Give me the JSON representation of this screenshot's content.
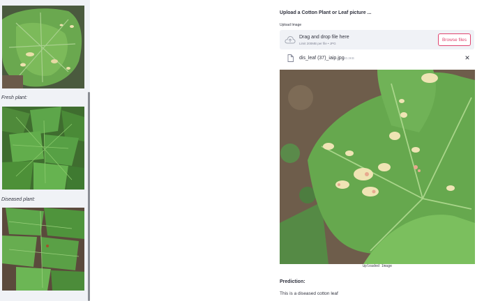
{
  "sidebar": {
    "captions": {
      "fresh": "Fresh plant:",
      "diseased": "Diseased plant:"
    }
  },
  "main": {
    "header": "Upload a Cotton Plant or Leaf picture ...",
    "uploader": {
      "label": "Upload Image",
      "drop_title": "Drag and drop file here",
      "limit_text": "Limit 200MB per file • JPG",
      "browse_label": "Browse files"
    },
    "file": {
      "name": "dis_leaf (37)_iaip.jpg",
      "size": "40.3KB",
      "remove_symbol": "✕"
    },
    "image_caption": "Uploaded Image",
    "prediction_label": "Prediction:",
    "prediction_text": "This is a diseased cotton leaf"
  },
  "colors": {
    "accent": "#e0436f",
    "sidebar_bg": "#f0f2f6",
    "text": "#31333f",
    "leaf_green": "#5da64a",
    "soil": "#6b5a4a"
  }
}
